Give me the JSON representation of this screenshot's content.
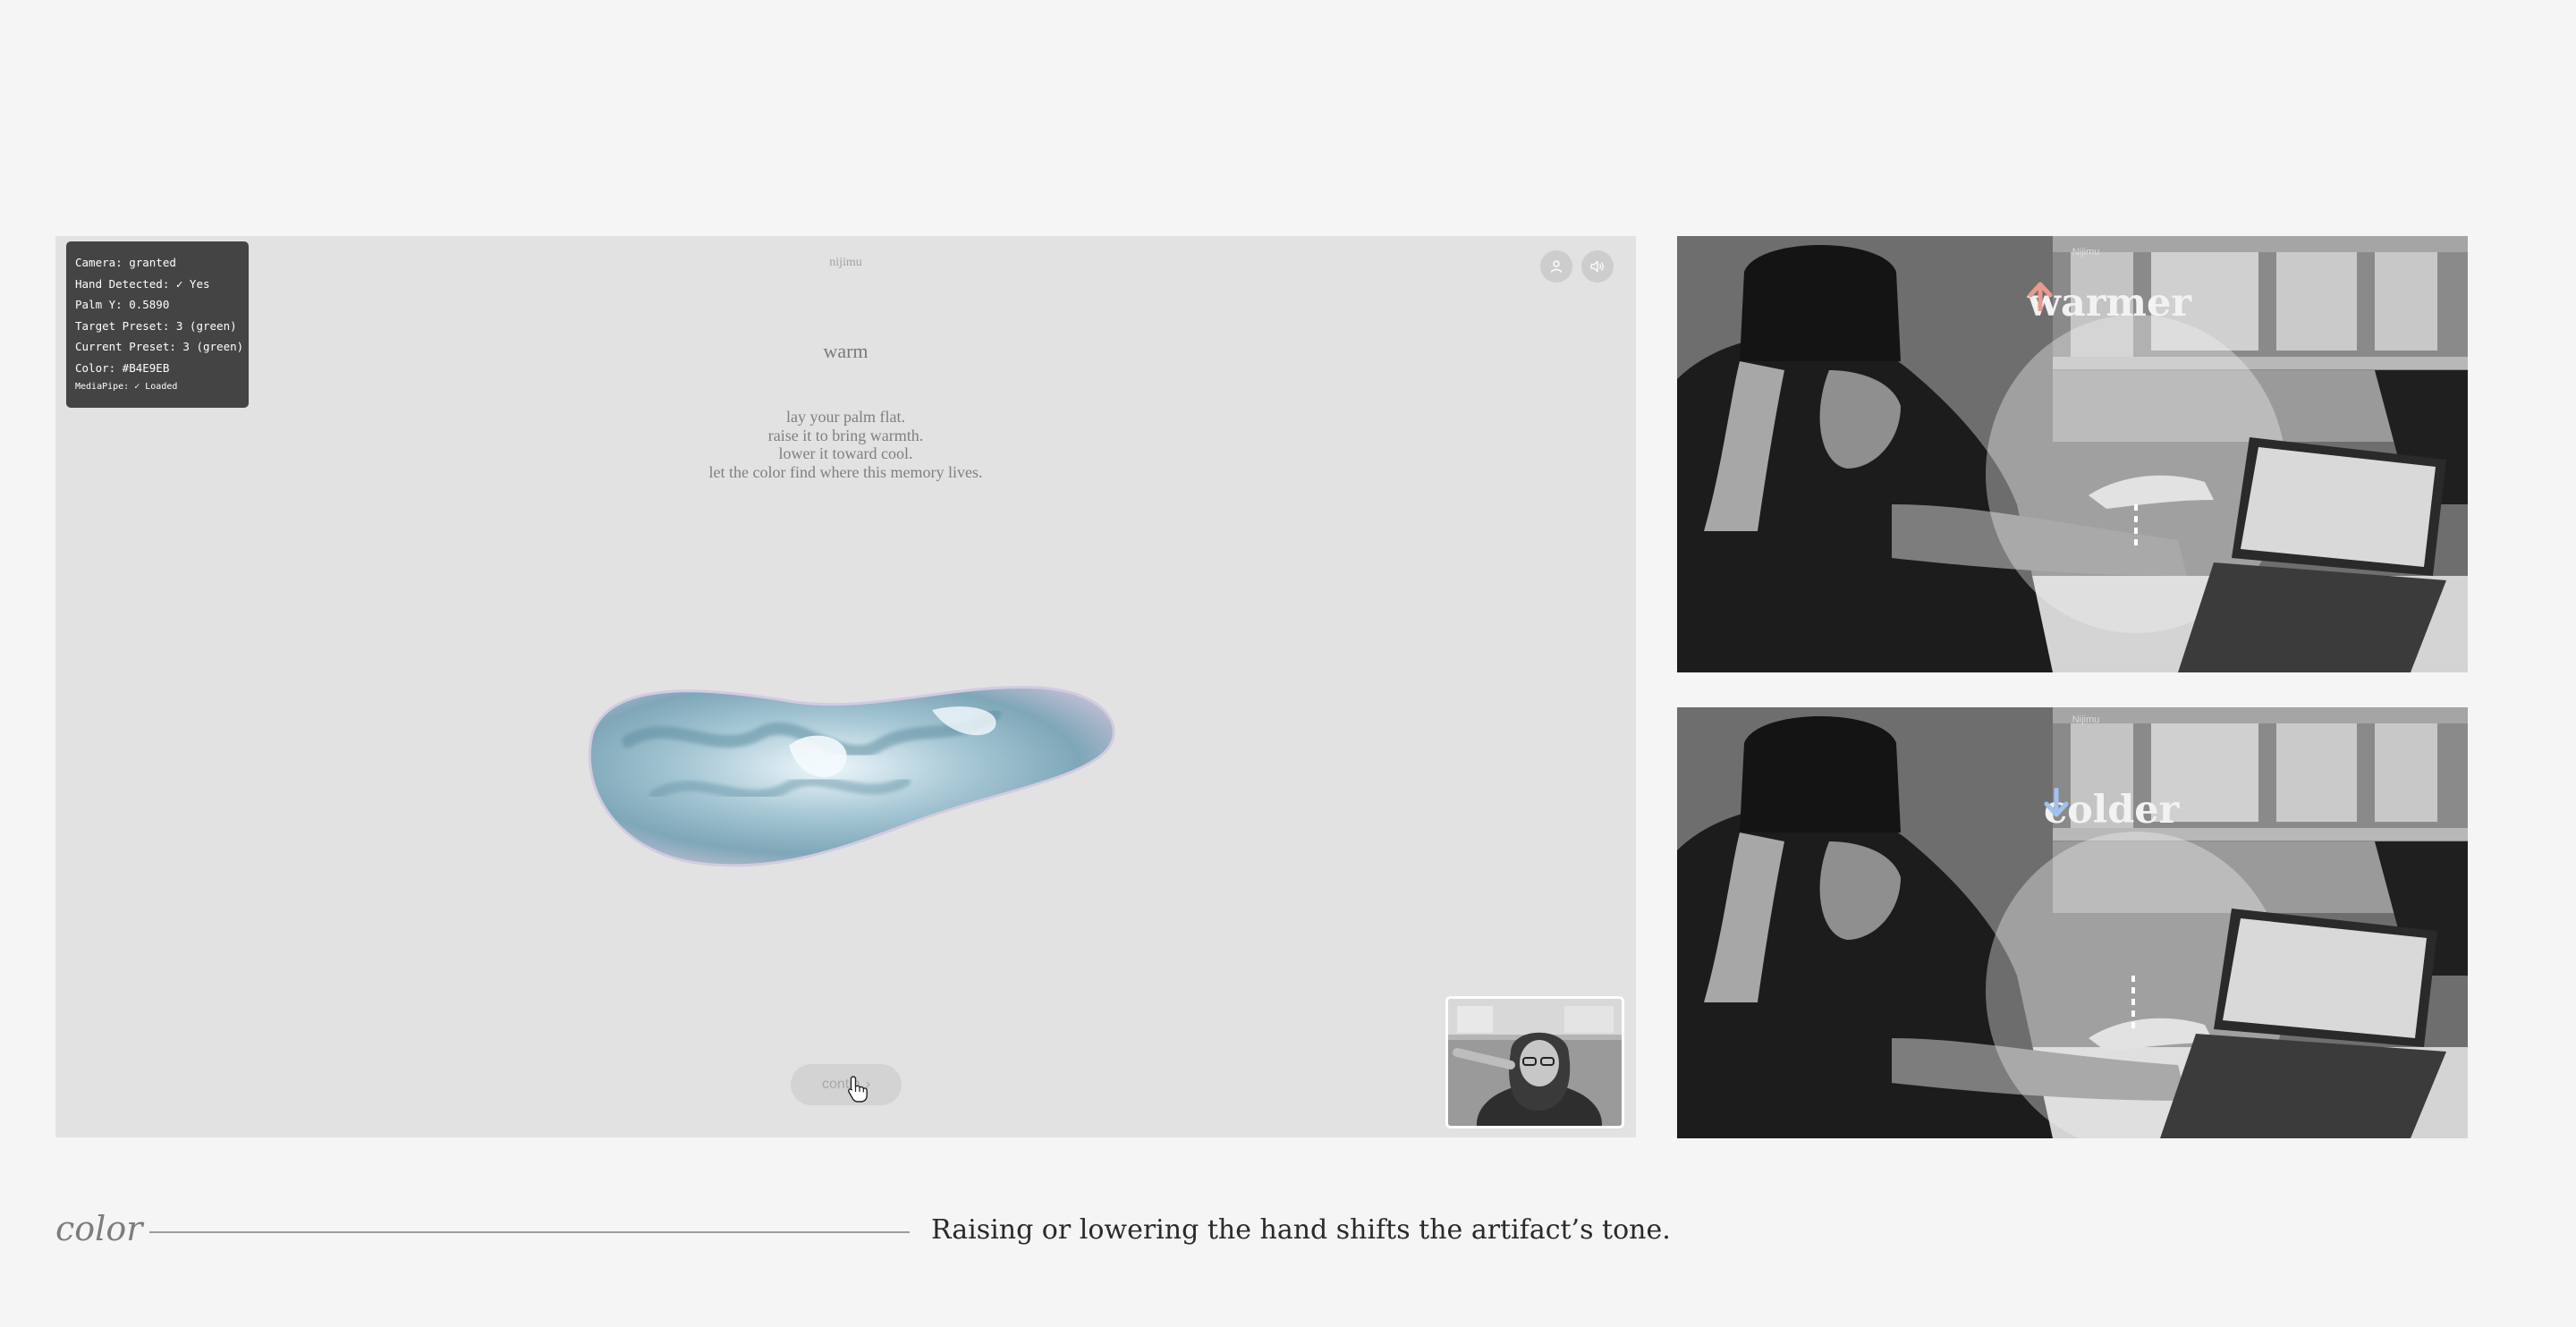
{
  "debug": {
    "camera": "Camera: granted",
    "hand": "Hand Detected: ✓ Yes",
    "palm": "Palm Y: 0.5890",
    "target": "Target Preset: 3 (green)",
    "current": "Current Preset: 3 (green)",
    "color": "Color: #B4E9EB",
    "mediapipe": "MediaPipe: ✓ Loaded"
  },
  "app": {
    "brand": "nijimu",
    "mood": "warm",
    "instructions": [
      "lay your palm flat.",
      "raise it to bring warmth.",
      "lower it toward cool.",
      "let the color find where this memory lives."
    ],
    "continue_label": "contin",
    "continue_chevron": "›",
    "icons": {
      "profile": "user-icon",
      "sound": "speaker-icon",
      "cursor": "hand-cursor-icon"
    },
    "blob_color": "#B4E9EB"
  },
  "photos": {
    "top": {
      "brand": "Nijimu",
      "label": "warmer",
      "arrow": "up-arrow-icon",
      "arrow_color": "#e89a8e"
    },
    "bottom": {
      "brand": "Nijimu",
      "label": "colder",
      "arrow": "down-arrow-icon",
      "arrow_color": "#9fc3ee"
    }
  },
  "caption": {
    "key": "color",
    "text": "Raising or lowering the hand shifts the artifact’s tone."
  }
}
